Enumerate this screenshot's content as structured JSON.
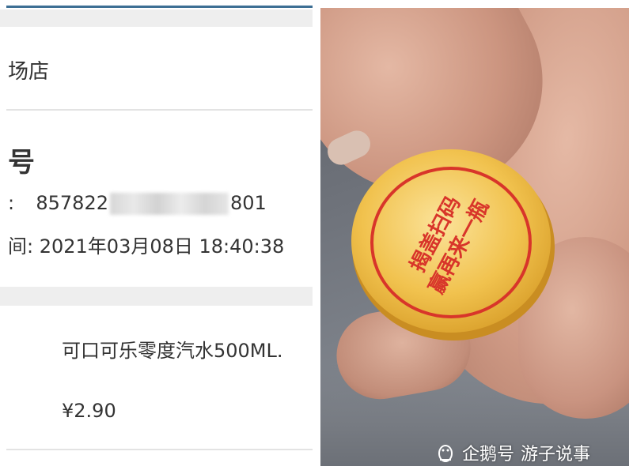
{
  "receipt": {
    "store_name_fragment": "场店",
    "heading_fragment": "号",
    "code_label_fragment": ":",
    "code_prefix": "857822",
    "code_suffix": "801",
    "time_label_fragment": "间:",
    "time_value": "2021年03月08日 18:40:38",
    "product_name": "可口可乐零度汽水500ML.",
    "price": "¥2.90"
  },
  "photo": {
    "cap_text_line1": "揭盖扫码",
    "cap_text_line2": "赢再来一瓶",
    "cap_color": "#f3c75a",
    "cap_text_color": "#d8352a"
  },
  "watermark": {
    "platform": "企鹅号",
    "account": "游子说事"
  }
}
